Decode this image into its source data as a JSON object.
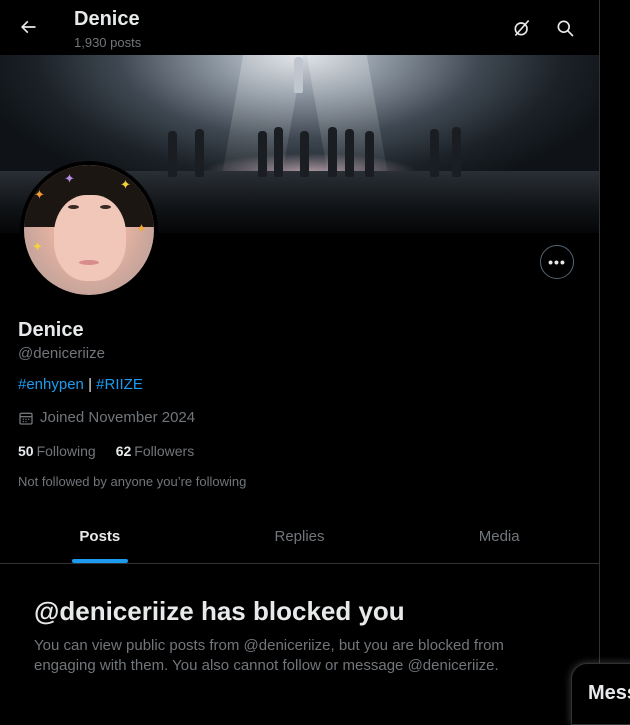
{
  "header": {
    "title": "Denice",
    "post_count": "1,930 posts"
  },
  "profile": {
    "display_name": "Denice",
    "handle": "@deniceriize",
    "bio": {
      "tag1": "#enhypen",
      "separator": " | ",
      "tag2": "#RIIZE"
    },
    "joined": "Joined November 2024",
    "following_count": "50",
    "following_label": "Following",
    "followers_count": "62",
    "followers_label": "Followers",
    "not_followed_text": "Not followed by anyone you’re following"
  },
  "tabs": [
    {
      "label": "Posts",
      "active": true
    },
    {
      "label": "Replies",
      "active": false
    },
    {
      "label": "Media",
      "active": false
    }
  ],
  "blocked": {
    "title": "@deniceriize has blocked you",
    "body": "You can view public posts from @deniceriize, but you are blocked from engaging with them. You also cannot follow or message @deniceriize."
  },
  "messages_drawer": {
    "label": "Mess"
  },
  "icons": {
    "back": "arrow-left-icon",
    "grok": "grok-icon",
    "search": "search-icon",
    "more": "more-icon",
    "calendar": "calendar-icon"
  },
  "colors": {
    "background": "#000000",
    "accent": "#1d9bf0",
    "text_primary": "#e7e9ea",
    "text_secondary": "#71767b",
    "border": "#2f3336"
  }
}
